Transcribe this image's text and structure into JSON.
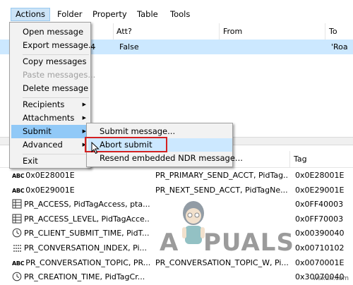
{
  "menubar": {
    "items": [
      "Actions",
      "Folder",
      "Property",
      "Table",
      "Tools"
    ]
  },
  "upper": {
    "columns": [
      "Att?",
      "From",
      "To"
    ],
    "row": {
      "fragment": "4",
      "att": "False",
      "to": "'Roa"
    }
  },
  "actions_menu": {
    "items": [
      {
        "label": "Open message",
        "disabled": false,
        "submenu": false
      },
      {
        "label": "Export message...",
        "disabled": false,
        "submenu": false
      },
      {
        "label": "Copy messages",
        "disabled": false,
        "submenu": false
      },
      {
        "label": "Paste messages...",
        "disabled": true,
        "submenu": false
      },
      {
        "label": "Delete message",
        "disabled": false,
        "submenu": false
      },
      {
        "label": "Recipients",
        "disabled": false,
        "submenu": true
      },
      {
        "label": "Attachments",
        "disabled": false,
        "submenu": true
      },
      {
        "label": "Submit",
        "disabled": false,
        "submenu": true,
        "highlighted": true
      },
      {
        "label": "Advanced",
        "disabled": false,
        "submenu": true
      },
      {
        "label": "Exit",
        "disabled": false,
        "submenu": false
      }
    ]
  },
  "submit_menu": {
    "items": [
      {
        "label": "Submit message..."
      },
      {
        "label": "Abort submit",
        "highlighted": true
      },
      {
        "label": "Resend embedded NDR message..."
      }
    ]
  },
  "lower": {
    "columns": [
      "Tag"
    ],
    "rows": [
      {
        "icon": "abc-icon",
        "name": "0x0E28001E",
        "other": "PR_PRIMARY_SEND_ACCT, PidTag...",
        "tag": "0x0E28001E"
      },
      {
        "icon": "abc-icon",
        "name": "0x0E29001E",
        "other": "PR_NEXT_SEND_ACCT, PidTagNe...",
        "tag": "0x0E29001E"
      },
      {
        "icon": "grid-icon",
        "name": "PR_ACCESS, PidTagAccess, pta...",
        "other": "",
        "tag": "0x0FF40003"
      },
      {
        "icon": "grid-icon",
        "name": "PR_ACCESS_LEVEL, PidTagAcce...",
        "other": "",
        "tag": "0x0FF70003"
      },
      {
        "icon": "clock-icon",
        "name": "PR_CLIENT_SUBMIT_TIME, PidT...",
        "other": "",
        "tag": "0x00390040"
      },
      {
        "icon": "dots-icon",
        "name": "PR_CONVERSATION_INDEX, Pi...",
        "other": "",
        "tag": "0x00710102"
      },
      {
        "icon": "abc-icon",
        "name": "PR_CONVERSATION_TOPIC, PR...",
        "other": "PR_CONVERSATION_TOPIC_W, Pi...",
        "tag": "0x0070001E"
      },
      {
        "icon": "clock-icon",
        "name": "PR_CREATION_TIME, PidTagCr...",
        "other": "",
        "tag": "0x30070040"
      }
    ]
  },
  "watermark": {
    "text_a": "A",
    "text_rest": "PUALS"
  },
  "site": "wsxdn.com",
  "colors": {
    "highlight": "#91c9f7",
    "selection": "#cce8ff",
    "red_box": "#d42020"
  }
}
